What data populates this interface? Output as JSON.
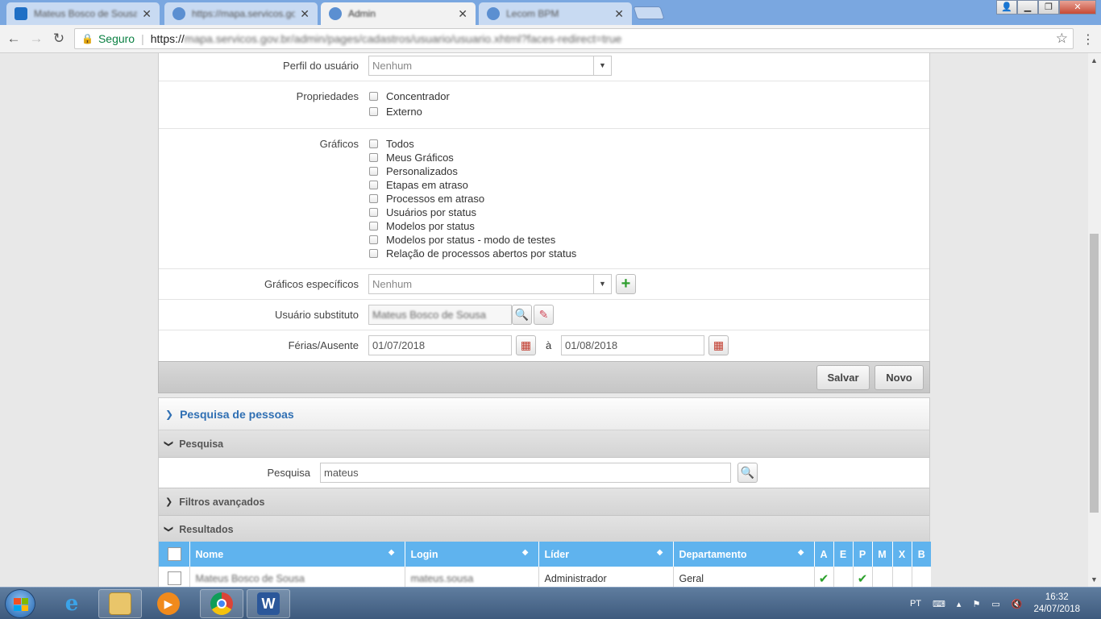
{
  "browser": {
    "tabs": [
      {
        "title": "Mateus Bosco de Sousa",
        "active": false,
        "favicon_color": "#1f6fc5"
      },
      {
        "title": "https://mapa.servicos.gov",
        "active": false,
        "favicon_color": "#5b8fd1"
      },
      {
        "title": "Admin",
        "active": true,
        "favicon_color": "#5b8fd1"
      },
      {
        "title": "Lecom BPM",
        "active": false,
        "favicon_color": "#5b8fd1"
      }
    ],
    "address": {
      "secure_label": "Seguro",
      "url_prefix": "https://",
      "url_rest": "mapa.servicos.gov.br/admin/pages/cadastros/usuario/usuario.xhtml?faces-redirect=true"
    }
  },
  "form": {
    "perfil": {
      "label": "Perfil do usuário",
      "value": "Nenhum"
    },
    "propriedades": {
      "label": "Propriedades",
      "options": [
        "Concentrador",
        "Externo"
      ]
    },
    "graficos": {
      "label": "Gráficos",
      "options": [
        "Todos",
        "Meus Gráficos",
        "Personalizados",
        "Etapas em atraso",
        "Processos em atraso",
        "Usuários por status",
        "Modelos por status",
        "Modelos por status - modo de testes",
        "Relação de processos abertos por status"
      ]
    },
    "graficos_especificos": {
      "label": "Gráficos específicos",
      "value": "Nenhum"
    },
    "usuario_substituto": {
      "label": "Usuário substituto",
      "value": "Mateus Bosco de Sousa"
    },
    "ferias": {
      "label": "Férias/Ausente",
      "from": "01/07/2018",
      "separator": "à",
      "to": "01/08/2018"
    },
    "buttons": {
      "save": "Salvar",
      "new": "Novo"
    }
  },
  "search": {
    "title": "Pesquisa de pessoas",
    "section_search": "Pesquisa",
    "search_label": "Pesquisa",
    "search_value": "mateus",
    "section_filters": "Filtros avançados",
    "section_results": "Resultados",
    "columns": [
      "Nome",
      "Login",
      "Líder",
      "Departamento",
      "A",
      "E",
      "P",
      "M",
      "X",
      "B"
    ],
    "rows": [
      {
        "nome": "Mateus Bosco de Sousa",
        "login": "mateus.sousa",
        "lider": "Administrador",
        "departamento": "Geral",
        "A": true,
        "E": false,
        "P": true,
        "M": false,
        "X": false,
        "B": false
      }
    ]
  },
  "taskbar": {
    "language": "PT",
    "time": "16:32",
    "date": "24/07/2018"
  },
  "colors": {
    "accent": "#2f6fb3",
    "table_header": "#5fb3ee",
    "check_green": "#2ba02b"
  }
}
